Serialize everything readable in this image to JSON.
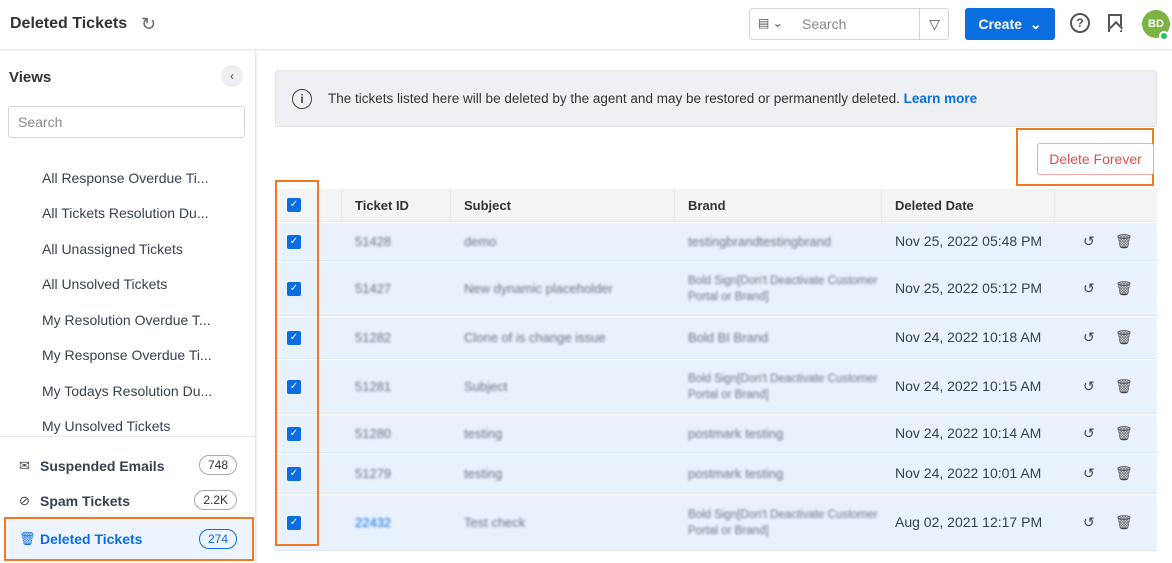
{
  "header": {
    "title": "Deleted Tickets",
    "search_placeholder": "Search",
    "create_label": "Create",
    "avatar_initials": "BD"
  },
  "sidebar": {
    "views_title": "Views",
    "search_placeholder": "Search",
    "views": [
      "All Response Overdue Ti...",
      "All Tickets Resolution Du...",
      "All Unassigned Tickets",
      "All Unsolved Tickets",
      "My Resolution Overdue T...",
      "My Response Overdue Ti...",
      "My Todays Resolution Du...",
      "My Unsolved Tickets"
    ],
    "folders": [
      {
        "label": "Suspended Emails",
        "count": "748",
        "icon": "mail-icon"
      },
      {
        "label": "Spam Tickets",
        "count": "2.2K",
        "icon": "ban-icon"
      },
      {
        "label": "Deleted Tickets",
        "count": "274",
        "icon": "trash-icon",
        "active": true
      }
    ]
  },
  "banner": {
    "text": "The tickets listed here will be deleted by the agent and may be restored or permanently deleted.",
    "link": "Learn more"
  },
  "actions": {
    "delete_forever": "Delete Forever"
  },
  "table": {
    "headers": [
      "Ticket ID",
      "Subject",
      "Brand",
      "Deleted Date"
    ],
    "rows": [
      {
        "id": "51428",
        "subject": "demo",
        "brand": "testingbrandtestingbrand",
        "date": "Nov 25, 2022 05:48 PM"
      },
      {
        "id": "51427",
        "subject": "New dynamic placeholder",
        "brand": "Bold Sign[Don't Deactivate Customer Portal or Brand]",
        "date": "Nov 25, 2022 05:12 PM"
      },
      {
        "id": "51282",
        "subject": "Clone of is change issue",
        "brand": "Bold BI Brand",
        "date": "Nov 24, 2022 10:18 AM"
      },
      {
        "id": "51281",
        "subject": "Subject",
        "brand": "Bold Sign[Don't Deactivate Customer Portal or Brand]",
        "date": "Nov 24, 2022 10:15 AM"
      },
      {
        "id": "51280",
        "subject": "testing",
        "brand": "postmark testing",
        "date": "Nov 24, 2022 10:14 AM"
      },
      {
        "id": "51279",
        "subject": "testing",
        "brand": "postmark testing",
        "date": "Nov 24, 2022 10:01 AM"
      },
      {
        "id": "22432",
        "subject": "Test check",
        "brand": "Bold Sign[Don't Deactivate Customer Portal or Brand]",
        "date": "Aug 02, 2021 12:17 PM"
      }
    ]
  },
  "colors": {
    "accent": "#0b6ee0",
    "highlight": "#f07a22",
    "danger": "#e24b4b"
  }
}
